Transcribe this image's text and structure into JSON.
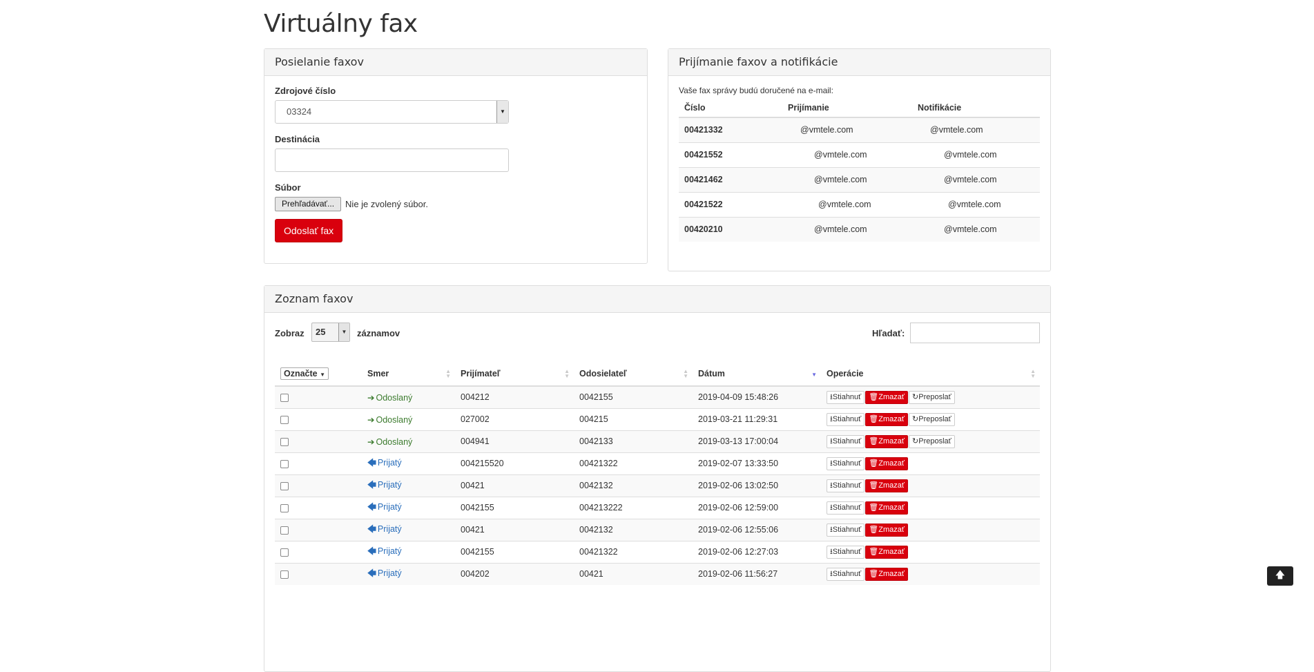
{
  "page_title": "Virtuálny fax",
  "send_panel": {
    "title": "Posielanie faxov",
    "source_label": "Zdrojové číslo",
    "source_value": "03324",
    "destination_label": "Destinácia",
    "destination_value": "",
    "file_label": "Súbor",
    "file_button": "Prehľadávať...",
    "file_status": "Nie je zvolený súbor.",
    "send_button": "Odoslať fax"
  },
  "receive_panel": {
    "title": "Prijímanie faxov a notifikácie",
    "info": "Vaše fax správy budú doručené na e-mail:",
    "headers": [
      "Číslo",
      "Prijímanie",
      "Notifikácie"
    ],
    "rows": [
      {
        "number": "00421332",
        "receive": "@vmtele.com",
        "notify": "@vmtele.com"
      },
      {
        "number": "00421552",
        "receive": "@vmtele.com",
        "notify": "@vmtele.com"
      },
      {
        "number": "00421462",
        "receive": "@vmtele.com",
        "notify": "@vmtele.com"
      },
      {
        "number": "00421522",
        "receive": "@vmtele.com",
        "notify": "@vmtele.com"
      },
      {
        "number": "00420210",
        "receive": "@vmtele.com",
        "notify": "@vmtele.com"
      }
    ]
  },
  "list_panel": {
    "title": "Zoznam faxov",
    "show_label": "Zobraz",
    "page_length": "25",
    "records_label": "záznamov",
    "search_label": "Hľadať:",
    "search_value": "",
    "headers": {
      "mark": "Označte",
      "direction": "Smer",
      "recipient": "Prijímateľ",
      "sender": "Odosielateľ",
      "date": "Dátum",
      "operations": "Operácie"
    },
    "actions": {
      "download": "Stiahnuť",
      "delete": "Zmazať",
      "forward": "Preposlať"
    },
    "rows": [
      {
        "direction": "Odoslaný",
        "type": "sent",
        "recipient": "004212",
        "sender": "0042155",
        "date": "2019-04-09 15:48:26"
      },
      {
        "direction": "Odoslaný",
        "type": "sent",
        "recipient": "027002",
        "sender": "004215",
        "date": "2019-03-21 11:29:31"
      },
      {
        "direction": "Odoslaný",
        "type": "sent",
        "recipient": "004941",
        "sender": "0042133",
        "date": "2019-03-13 17:00:04"
      },
      {
        "direction": "Prijatý",
        "type": "received",
        "recipient": "004215520",
        "sender": "00421322",
        "date": "2019-02-07 13:33:50"
      },
      {
        "direction": "Prijatý",
        "type": "received",
        "recipient": "00421",
        "sender": "0042132",
        "date": "2019-02-06 13:02:50"
      },
      {
        "direction": "Prijatý",
        "type": "received",
        "recipient": "0042155",
        "sender": "004213222",
        "date": "2019-02-06 12:59:00"
      },
      {
        "direction": "Prijatý",
        "type": "received",
        "recipient": "00421",
        "sender": "0042132",
        "date": "2019-02-06 12:55:06"
      },
      {
        "direction": "Prijatý",
        "type": "received",
        "recipient": "0042155",
        "sender": "00421322",
        "date": "2019-02-06 12:27:03"
      },
      {
        "direction": "Prijatý",
        "type": "received",
        "recipient": "004202",
        "sender": "00421",
        "date": "2019-02-06 11:56:27"
      }
    ]
  },
  "colors": {
    "accent_red": "#d9000d",
    "sent_green": "#3c7b2e",
    "received_blue": "#2a6ebb"
  },
  "icons": {
    "sent": "arrow-right-icon",
    "received": "arrow-left-icon",
    "download": "download-icon",
    "delete": "trash-icon",
    "forward": "refresh-icon",
    "scroll_top": "arrow-up-icon"
  }
}
